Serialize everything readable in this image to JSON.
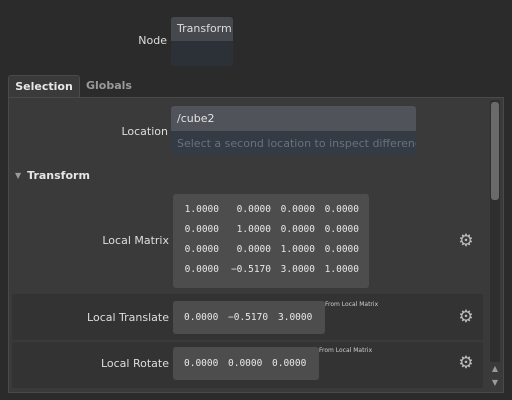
{
  "node": {
    "label": "Node",
    "value": "Transform"
  },
  "tabs": [
    {
      "label": "Selection"
    },
    {
      "label": "Globals"
    }
  ],
  "location": {
    "label": "Location",
    "value": "/cube2",
    "placeholder": "Select a second location to inspect differences"
  },
  "section": {
    "title": "Transform"
  },
  "local_matrix": {
    "label": "Local Matrix",
    "rows": [
      [
        "1.0000",
        "0.0000",
        "0.0000",
        "0.0000"
      ],
      [
        "0.0000",
        "1.0000",
        "0.0000",
        "0.0000"
      ],
      [
        "0.0000",
        "0.0000",
        "1.0000",
        "0.0000"
      ],
      [
        "0.0000",
        "−0.5170",
        "3.0000",
        "1.0000"
      ]
    ]
  },
  "local_translate": {
    "label": "Local Translate",
    "values": [
      "0.0000",
      "−0.5170",
      "3.0000"
    ],
    "note": "From Local Matrix"
  },
  "local_rotate": {
    "label": "Local Rotate",
    "values": [
      "0.0000",
      "0.0000",
      "0.0000"
    ],
    "note": "From Local Matrix"
  },
  "icons": {
    "gear": "gear-icon",
    "collapse": "triangle-down-icon",
    "scroll_up": "arrow-up-icon",
    "scroll_down": "arrow-down-icon"
  }
}
